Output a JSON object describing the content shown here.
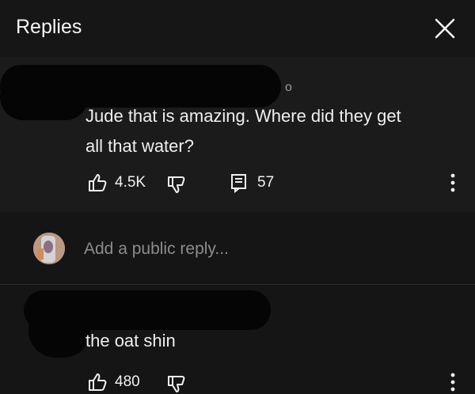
{
  "header": {
    "title": "Replies",
    "close_icon": "close-icon"
  },
  "main_comment": {
    "edited_mark": "o",
    "text_line1": "Jude that is amazing. Where did they get",
    "text_line2": "all that water?",
    "likes": "4.5K",
    "replies_count": "57",
    "icons": [
      "thumbs-up-icon",
      "thumbs-down-icon",
      "reply-comments-icon",
      "more-vertical-icon"
    ]
  },
  "reply_box": {
    "placeholder": "Add a public reply..."
  },
  "reply_comment": {
    "text": "the oat shin",
    "likes": "480",
    "icons": [
      "thumbs-up-icon",
      "thumbs-down-icon",
      "more-vertical-icon"
    ]
  },
  "colors": {
    "background": "#151515",
    "comment_background": "#1b1b1b",
    "text": "#f1f1f1",
    "secondary_text": "#8c8c8c",
    "redaction": "#050505"
  }
}
